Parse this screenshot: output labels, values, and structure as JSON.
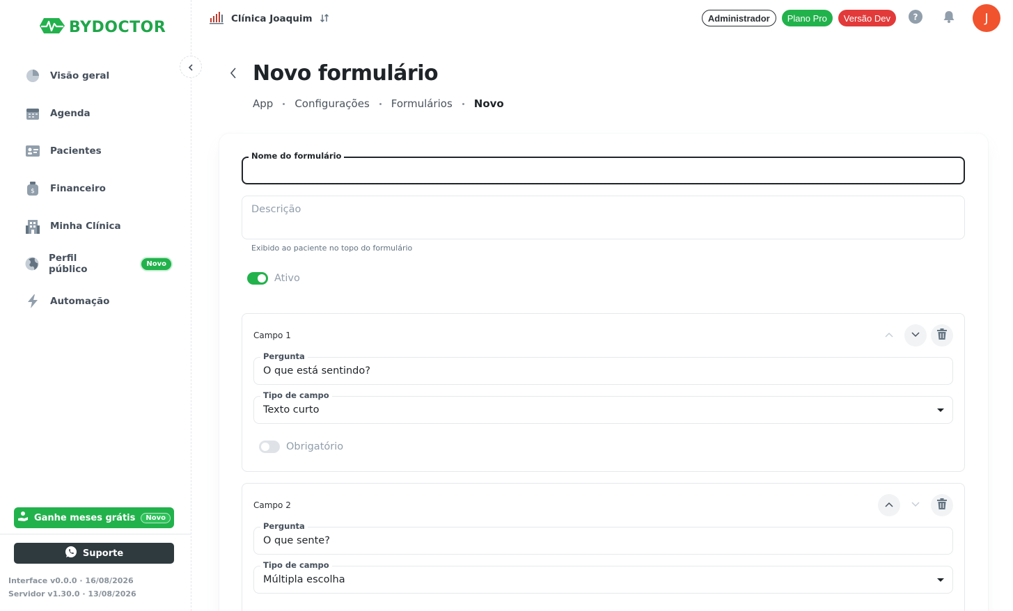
{
  "app": {
    "logo_text": "BYDOCTOR"
  },
  "sidebar": {
    "items": [
      {
        "label": "Visão geral",
        "icon": "pie-chart-icon"
      },
      {
        "label": "Agenda",
        "icon": "calendar-icon"
      },
      {
        "label": "Pacientes",
        "icon": "id-card-icon"
      },
      {
        "label": "Financeiro",
        "icon": "wallet-icon"
      },
      {
        "label": "Minha Clínica",
        "icon": "building-icon"
      },
      {
        "label": "Perfil público",
        "icon": "globe-icon",
        "badge": "Novo"
      },
      {
        "label": "Automação",
        "icon": "lightning-icon"
      }
    ],
    "promo": {
      "label": "Ganhe meses grátis",
      "badge": "Novo"
    },
    "support": {
      "label": "Suporte"
    },
    "versions": {
      "interface": "Interface v0.0.0 · 16/08/2026",
      "server": "Servidor v1.30.0 · 13/08/2026"
    }
  },
  "topbar": {
    "clinic_name": "Clínica Joaquim",
    "role": "Administrador",
    "plan": "Plano Pro",
    "env": "Versão Dev",
    "avatar_initial": "J"
  },
  "page": {
    "title": "Novo formulário",
    "breadcrumb": [
      "App",
      "Configurações",
      "Formulários",
      "Novo"
    ]
  },
  "form": {
    "name_label": "Nome do formulário",
    "name_value": "",
    "description_placeholder": "Descrição",
    "description_helper": "Exibido ao paciente no topo do formulário",
    "active_label": "Ativo",
    "active": true
  },
  "campos": [
    {
      "title": "Campo 1",
      "question_label": "Pergunta",
      "question": "O que está sentindo?",
      "type_label": "Tipo de campo",
      "type": "Texto curto",
      "required_label": "Obrigatório",
      "required": false
    },
    {
      "title": "Campo 2",
      "question_label": "Pergunta",
      "question": "O que sente?",
      "type_label": "Tipo de campo",
      "type": "Múltipla escolha"
    }
  ],
  "colors": {
    "brand_green": "#22b24c",
    "dev_red": "#e23a3a",
    "avatar_orange": "#f0532e",
    "support_dark": "#2f3a3f"
  }
}
